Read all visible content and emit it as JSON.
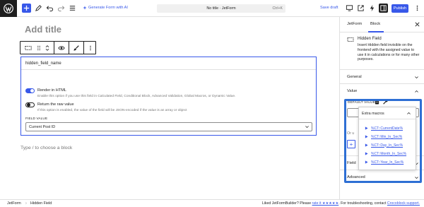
{
  "colors": {
    "accent": "#3858e9",
    "dark": "#1e1e1e",
    "muted": "#757575",
    "callout": "#2e6fd4"
  },
  "topbar": {
    "icons": [
      "wordpress-logo-icon",
      "plus-icon",
      "pen-icon",
      "undo-icon",
      "redo-icon",
      "list-view-icon",
      "sparkle-icon",
      "desktop-icon",
      "external-icon",
      "lightning-icon",
      "sidebar-toggle-icon",
      "more-vertical-icon"
    ],
    "ai_label": "Generate Form with AI",
    "doc_title": "No title · JetForm",
    "doc_shortcut": "Ctrl+K",
    "save_draft": "Save draft",
    "publish": "Publish"
  },
  "canvas": {
    "title_placeholder": "Add title",
    "block": {
      "field_name": "hidden_field_name",
      "render_html": {
        "label": "Render in HTML",
        "help": "Enable this option if you use this field in Calculated Field, Conditional Block, Advanced Validation, Global Macros, or Dynamic Value.",
        "enabled": true
      },
      "raw_value": {
        "label": "Return the raw value",
        "help": "If this option is enabled, the value of the field will be JSON-encoded if the value is an array or object",
        "enabled": false
      },
      "field_value_label": "FIELD VALUE",
      "field_value": "Current Post ID"
    },
    "placeholder": "Type / to choose a block"
  },
  "sidebar": {
    "tabs": [
      {
        "label": "JetForm",
        "active": false
      },
      {
        "label": "Block",
        "active": true
      }
    ],
    "card": {
      "title": "Hidden Field",
      "description": "Insert Hidden field invisible on the frontend with the assigned value to use it in calculations or for many other purposes."
    },
    "panels": {
      "general": "General",
      "value": "Value",
      "field": "Field",
      "advanced": "Advanced"
    },
    "default_value_label": "DEFAULT VALUE",
    "or_fragment": "Or u",
    "popover": {
      "title": "Extra macros",
      "macros": [
        "%CT::CurrentDate%",
        "%CT::Min_In_Sec%",
        "%CT::Day_In_Sec%",
        "%CT::Month_In_Sec%",
        "%CT::Year_In_Sec%"
      ]
    }
  },
  "footer": {
    "breadcrumb": [
      "JetForm",
      "Hidden Field"
    ],
    "crumb_sep": "›",
    "rate_prefix": "Liked JetFormBuilder? Please ",
    "rate_link": "rate it ★★★★★",
    "rate_middle": ". For troubleshooting, contact ",
    "support_link": "Crocoblock support."
  }
}
